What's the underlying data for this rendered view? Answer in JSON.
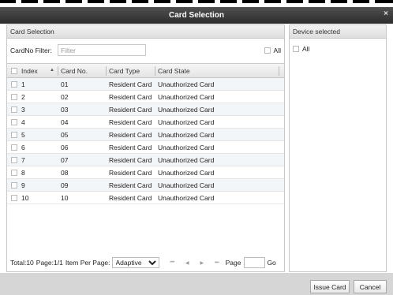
{
  "window": {
    "title": "Card Selection",
    "close_label": "×"
  },
  "card_selection": {
    "panel_title": "Card Selection",
    "filter_label": "CardNo Filter:",
    "filter_placeholder": "Filter",
    "all_label": "All",
    "columns": {
      "index": "Index",
      "sort_glyph": "▲",
      "card_no": "Card No.",
      "card_type": "Card Type",
      "card_state": "Card State"
    },
    "rows": [
      {
        "index": "1",
        "card_no": "01",
        "card_type": "Resident Card",
        "card_state": "Unauthorized Card"
      },
      {
        "index": "2",
        "card_no": "02",
        "card_type": "Resident Card",
        "card_state": "Unauthorized Card"
      },
      {
        "index": "3",
        "card_no": "03",
        "card_type": "Resident Card",
        "card_state": "Unauthorized Card"
      },
      {
        "index": "4",
        "card_no": "04",
        "card_type": "Resident Card",
        "card_state": "Unauthorized Card"
      },
      {
        "index": "5",
        "card_no": "05",
        "card_type": "Resident Card",
        "card_state": "Unauthorized Card"
      },
      {
        "index": "6",
        "card_no": "06",
        "card_type": "Resident Card",
        "card_state": "Unauthorized Card"
      },
      {
        "index": "7",
        "card_no": "07",
        "card_type": "Resident Card",
        "card_state": "Unauthorized Card"
      },
      {
        "index": "8",
        "card_no": "08",
        "card_type": "Resident Card",
        "card_state": "Unauthorized Card"
      },
      {
        "index": "9",
        "card_no": "09",
        "card_type": "Resident Card",
        "card_state": "Unauthorized Card"
      },
      {
        "index": "10",
        "card_no": "10",
        "card_type": "Resident Card",
        "card_state": "Unauthorized Card"
      }
    ],
    "pager": {
      "total": "Total:10",
      "page": "Page:1/1",
      "items_label": "Item Per Page:",
      "items_value": "Adaptive",
      "first": "⏮",
      "prev": "◀",
      "next": "▶",
      "last": "⏭",
      "page_label": "Page",
      "go_label": "Go"
    }
  },
  "device": {
    "panel_title": "Device selected",
    "all_label": "All"
  },
  "footer": {
    "issue_card": "Issue Card",
    "cancel": "Cancel"
  }
}
